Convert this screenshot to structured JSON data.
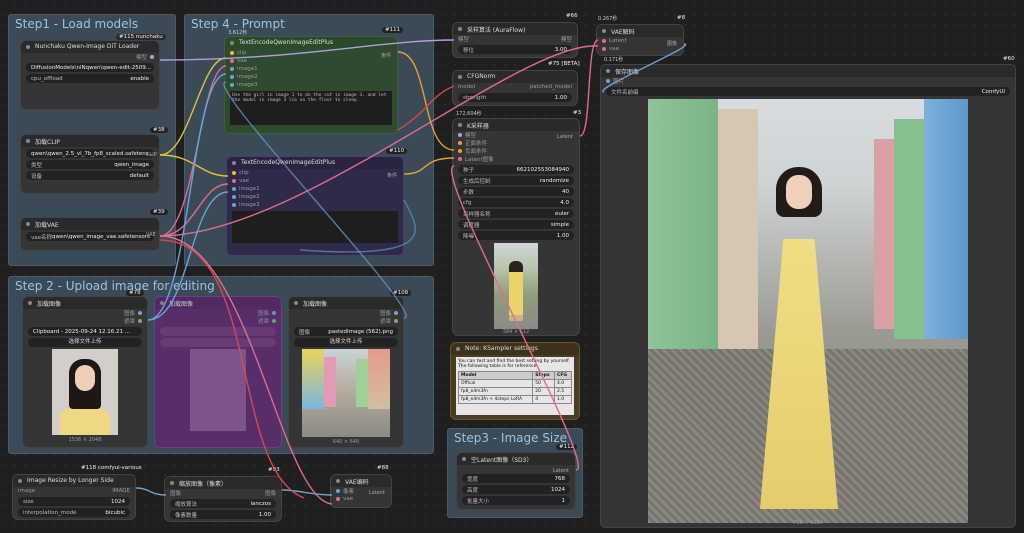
{
  "colors": {
    "blue_group": "#2e4354",
    "purple": "#2e2a47",
    "green": "#2c4a2c",
    "note": "#4a3b23",
    "wire_yellow": "#e6c22e",
    "wire_pink": "#e06b8f",
    "wire_red": "#d54a4a",
    "wire_blue": "#6aa3d9"
  },
  "groups": {
    "step1": "Step1 - Load models",
    "step4": "Step 4 - Prompt",
    "step2": "Step 2 - Upload image for editing",
    "step3": "Step3 - Image Size"
  },
  "nodes": {
    "unet": {
      "badge": "#115 nunchaku",
      "title": "Nunchaku Qwen-Image DiT Loader",
      "out": "模型",
      "w1": "DiffusionModels\\nlNqwen\\qwen-edit-2509...",
      "w2l": "cpu_offload",
      "w2v": "enable"
    },
    "clip": {
      "badge": "#38",
      "title": "加载CLIP",
      "out": "CLIP",
      "w1": "qwen\\qwen_2.5_vl_7b_fp8_scaled.safetens...",
      "w2l": "类型",
      "w2v": "qwen_image",
      "w3l": "设备",
      "w3v": "default"
    },
    "vae": {
      "badge": "#39",
      "title": "加载VAE",
      "out": "VAE",
      "w1l": "vae名称",
      "w1v": "qwen\\qwen_image_vae.safetensors"
    },
    "te1": {
      "badge": "#111",
      "time": "3.612秒",
      "title": "TextEncodeQwenImageEditPlus",
      "in": [
        "clip",
        "vae",
        "image1",
        "image2",
        "image3"
      ],
      "out": "条件",
      "text": "Use the girl in image 1 to do the cut in image 3, and let the model in image 3 lie on the floor to sleep."
    },
    "te2": {
      "badge": "#110",
      "title": "TextEncodeQwenImageEditPlus",
      "in": [
        "clip",
        "vae",
        "image1",
        "image2",
        "image3"
      ],
      "out": "条件"
    },
    "aura": {
      "badge": "#66",
      "title": "采样算法 (AuraFlow)",
      "in": "模型",
      "out": "模型",
      "wl": "移位",
      "wv": "3.00"
    },
    "cfgnorm": {
      "badge": "#75 [BETA]",
      "title": "CFGNorm",
      "in": "model",
      "out": "patched_model",
      "wl": "strength",
      "wv": "1.00"
    },
    "ks": {
      "badge": "#3",
      "time": "172.604秒",
      "title": "K采样器",
      "ins": [
        "模型",
        "正面条件",
        "负面条件",
        "Latent图像"
      ],
      "out": "Latent",
      "widgets": [
        [
          "种子",
          "662102553084940"
        ],
        [
          "生成后控制",
          "randomize"
        ],
        [
          "步数",
          "40"
        ],
        [
          "cfg",
          "4.0"
        ],
        [
          "采样器名称",
          "euler"
        ],
        [
          "调度器",
          "simple"
        ],
        [
          "降噪",
          "1.00"
        ]
      ],
      "cap": "384 × 512"
    },
    "vaedec": {
      "badge": "#8",
      "time": "0.267秒",
      "title": "VAE解码",
      "ins": [
        "Latent",
        "vae"
      ],
      "out": "图像"
    },
    "save": {
      "badge": "#60",
      "time": "0.171秒",
      "title": "保存图像",
      "in": "图片",
      "wl": "文件名前缀",
      "wv": "ComfyUI",
      "cap": "768 × 1024"
    },
    "load1": {
      "badge": "#78",
      "title": "加载图像",
      "outs": [
        "图像",
        "遮罩"
      ],
      "file": "Clipboard - 2025-09-24 12.16.21 ...",
      "upload": "选择文件上传",
      "cap": "1536 × 2048"
    },
    "load2": {
      "title": "加载图像",
      "outs": [
        "图像",
        "遮罩"
      ]
    },
    "load3": {
      "badge": "#108",
      "title": "加载图像",
      "outs": [
        "图像",
        "遮罩"
      ],
      "wl": "图像",
      "wv": "pastedImage (562).png",
      "upload": "选择文件上传",
      "cap": "640 × 640"
    },
    "note": {
      "title": "Note: KSampler settings",
      "text": "You can test and find the best setting by yourself. The following table is for reference.",
      "head": [
        "Model",
        "Steps",
        "CFG"
      ],
      "rows": [
        [
          "Offical",
          "50",
          "4.0"
        ],
        [
          "fp8_e4m3fn",
          "20",
          "2.5"
        ],
        [
          "fp8_e4m3fn + 4steps LoRA",
          "4",
          "1.0"
        ]
      ]
    },
    "latent": {
      "badge": "#112",
      "title": "空Latent图像（SD3）",
      "out": "Latent",
      "widgets": [
        [
          "宽度",
          "768"
        ],
        [
          "高度",
          "1024"
        ],
        [
          "批量大小",
          "1"
        ]
      ]
    },
    "resize": {
      "badge": "#118 comfyui-various",
      "title": "Image Resize by Longer Side",
      "in": "image",
      "out": "IMAGE",
      "widgets": [
        [
          "size",
          "1024"
        ],
        [
          "interpolation_mode",
          "bicubic"
        ]
      ]
    },
    "scale": {
      "badge": "#93",
      "title": "缩放图像（像素）",
      "in": "图像",
      "out": "图像",
      "widgets": [
        [
          "缩放算法",
          "lanczos"
        ],
        [
          "像素数量",
          "1.00"
        ]
      ]
    },
    "vaeenc": {
      "badge": "#88",
      "title": "VAE编码",
      "ins": [
        "像素",
        "vae"
      ],
      "out": "Latent"
    }
  }
}
